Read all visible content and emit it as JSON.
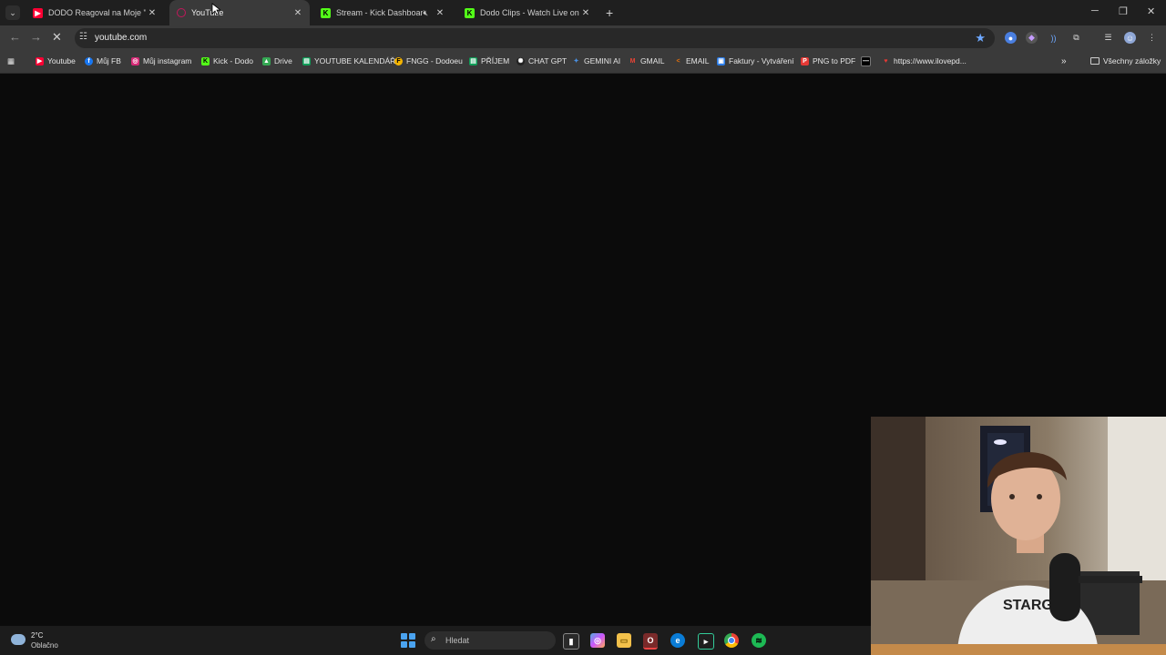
{
  "tabs": [
    {
      "title": "DODO Reagoval na Moje \"Špec",
      "favicon": "youtube-icon",
      "color": "#ff0033"
    },
    {
      "title": "YouTube",
      "favicon": "loading-icon",
      "color": "#c2185b",
      "active": true
    },
    {
      "title": "Stream - Kick Dashboard",
      "favicon": "kick-icon",
      "color": "#53fc18"
    },
    {
      "title": "Dodo Clips - Watch Live on Kick",
      "favicon": "kick-icon",
      "color": "#53fc18"
    }
  ],
  "address_bar": {
    "url": "youtube.com"
  },
  "bookmarks": [
    {
      "label": "Youtube",
      "icon": "youtube-icon",
      "color": "#ff0033"
    },
    {
      "label": "Můj FB",
      "icon": "facebook-icon",
      "color": "#1877f2"
    },
    {
      "label": "Můj instagram",
      "icon": "instagram-icon",
      "color": "#d62976"
    },
    {
      "label": "Kick - Dodo",
      "icon": "kick-icon",
      "color": "#53fc18"
    },
    {
      "label": "Drive",
      "icon": "drive-icon",
      "color": "#34a853"
    },
    {
      "label": "YOUTUBE KALENDÁŘ",
      "icon": "sheets-icon",
      "color": "#0f9d58"
    },
    {
      "label": "FNGG - Dodoeu",
      "icon": "fngg-icon",
      "color": "#f4b400"
    },
    {
      "label": "PŘÍJEM",
      "icon": "sheets-icon",
      "color": "#0f9d58"
    },
    {
      "label": "CHAT GPT",
      "icon": "openai-icon",
      "color": "#222222"
    },
    {
      "label": "GEMINI AI",
      "icon": "gemini-icon",
      "color": "#4a90e2"
    },
    {
      "label": "GMAIL",
      "icon": "gmail-icon",
      "color": "#ea4335"
    },
    {
      "label": "EMAIL",
      "icon": "email-icon",
      "color": "#e8710a"
    },
    {
      "label": "Faktury - Vytváření",
      "icon": "invoice-icon",
      "color": "#2b7de9"
    },
    {
      "label": "PNG to PDF",
      "icon": "pdf-icon",
      "color": "#e53935"
    },
    {
      "label": "",
      "icon": "dash-icon",
      "color": "#ffffff"
    },
    {
      "label": "https://www.ilovepd...",
      "icon": "heart-icon",
      "color": "#e53935"
    }
  ],
  "all_bookmarks": "Všechny záložky",
  "taskbar": {
    "weather_temp": "2°C",
    "weather_desc": "Oblačno",
    "search_placeholder": "Hledat"
  },
  "colors": {
    "page_bg": "#0b0b0b",
    "chrome_bg": "#3a3a3a",
    "accent": "#6ea8ff"
  }
}
